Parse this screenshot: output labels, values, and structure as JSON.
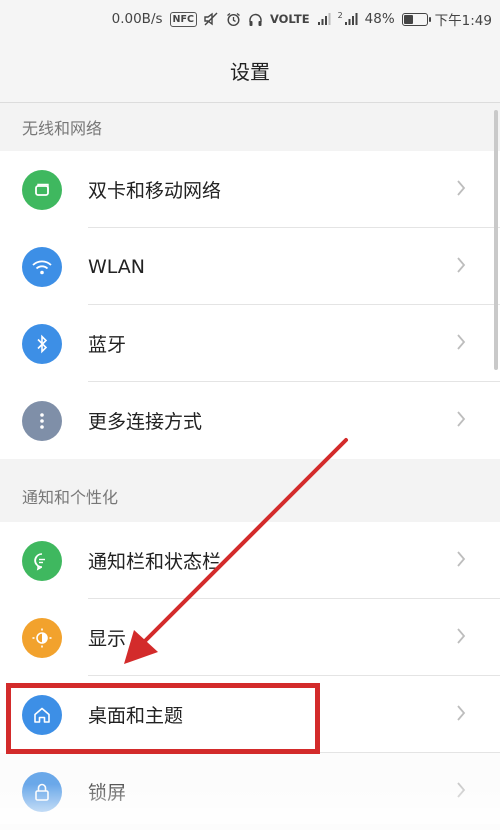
{
  "status_bar": {
    "speed": "0.00B/s",
    "nfc": "NFC",
    "volte": "VOLTE",
    "sim2": "2",
    "battery": "48%",
    "battery_level": 0.48,
    "time": "下午1:49"
  },
  "header": {
    "title": "设置"
  },
  "sections": [
    {
      "title": "无线和网络",
      "items": [
        {
          "label": "双卡和移动网络",
          "icon": "sim-card-icon",
          "color": "#3fb85f"
        },
        {
          "label": "WLAN",
          "icon": "wifi-icon",
          "color": "#3d8fe6"
        },
        {
          "label": "蓝牙",
          "icon": "bluetooth-icon",
          "color": "#3d8fe6"
        },
        {
          "label": "更多连接方式",
          "icon": "more-dots-icon",
          "color": "#7f8fa8"
        }
      ]
    },
    {
      "title": "通知和个性化",
      "items": [
        {
          "label": "通知栏和状态栏",
          "icon": "chat-bubble-icon",
          "color": "#3fb85f"
        },
        {
          "label": "显示",
          "icon": "brightness-icon",
          "color": "#f2a22d"
        },
        {
          "label": "桌面和主题",
          "icon": "home-icon",
          "color": "#3d8fe6"
        },
        {
          "label": "锁屏",
          "icon": "lock-icon",
          "color": "#3d8fe6"
        }
      ]
    }
  ],
  "colors": {
    "annotation": "#d32b2b",
    "green": "#3fb85f",
    "blue": "#3d8fe6",
    "orange": "#f2a22d",
    "grey": "#7f8fa8"
  }
}
